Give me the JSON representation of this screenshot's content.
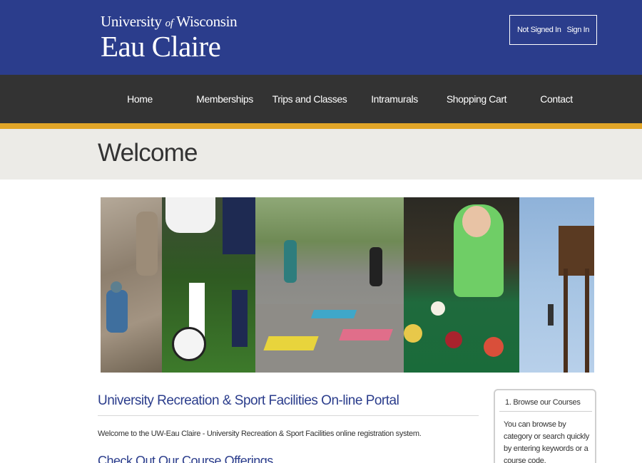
{
  "header": {
    "logo_line1_a": "University",
    "logo_line1_of": "of",
    "logo_line1_b": "Wisconsin",
    "logo_line2": "Eau Claire",
    "status_text": "Not Signed In",
    "sign_in_label": "Sign In",
    "background_color": "#2b3d8c"
  },
  "nav": {
    "items": [
      {
        "label": "Home"
      },
      {
        "label": "Memberships"
      },
      {
        "label": "Trips and Classes"
      },
      {
        "label": "Intramurals"
      },
      {
        "label": "Shopping Cart"
      },
      {
        "label": "Contact"
      }
    ],
    "background_color": "#333333",
    "accent_color": "#e1a527"
  },
  "welcome": {
    "title": "Welcome"
  },
  "main": {
    "portal_title": "University Recreation & Sport Facilities On-line Portal",
    "intro_text": "Welcome to the UW-Eau Claire - University Recreation & Sport Facilities online registration system.",
    "offerings_title": "Check Out Our Course Offerings"
  },
  "sidebar": {
    "step_title": "1. Browse our Courses",
    "step_text": "You can browse by category or search quickly by entering keywords or a course code."
  }
}
